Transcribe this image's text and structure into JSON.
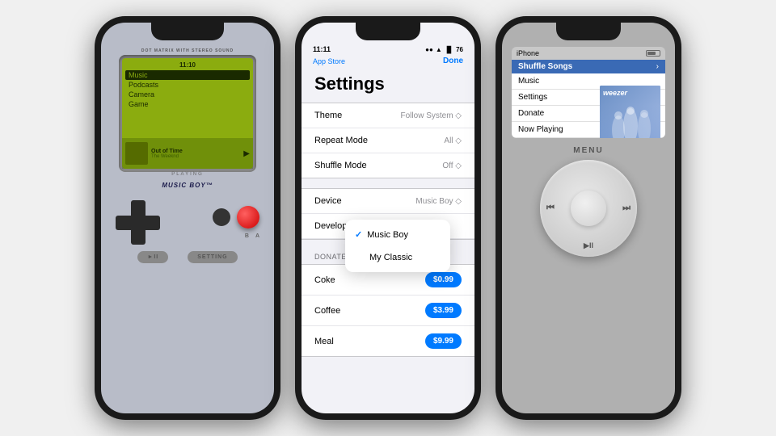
{
  "device1": {
    "brand": "MUSIC BOY",
    "trademark": "™",
    "label_top": "DOT MATRIX WITH STEREO SOUND",
    "screen_time": "11:10",
    "playing_label": "PLAYING",
    "menu_items": [
      "Music",
      "Podcasts",
      "Camera",
      "Game"
    ],
    "active_item": "Music",
    "track_name": "Out of Time",
    "track_artist": "The Weeknd",
    "bottom_btn1": "►II",
    "bottom_btn2": "SETTING"
  },
  "device2": {
    "status_time": "11:11",
    "app_store_label": "App Store",
    "done_label": "Done",
    "title": "Settings",
    "rows": [
      {
        "label": "Theme",
        "value": "Follow System"
      },
      {
        "label": "Repeat Mode",
        "value": "All"
      },
      {
        "label": "Shuffle Mode",
        "value": "Off"
      }
    ],
    "device_row": {
      "label": "Device",
      "value": "Music Boy"
    },
    "developer_row": {
      "label": "Developer",
      "value": ""
    },
    "dropdown_items": [
      {
        "label": "Music Boy",
        "checked": true
      },
      {
        "label": "My Classic",
        "checked": false
      }
    ],
    "donate_section_header": "DONATE",
    "donate_items": [
      {
        "label": "Coke",
        "price": "$0.99"
      },
      {
        "label": "Coffee",
        "price": "$3.99"
      },
      {
        "label": "Meal",
        "price": "$9.99"
      }
    ]
  },
  "device3": {
    "device_name": "iPhone",
    "menu_item": "Shuffle Songs",
    "list_items": [
      "Music",
      "Settings",
      "Donate",
      "Now Playing"
    ],
    "artist": "weezer",
    "wheel_menu": "MENU",
    "wheel_prev": "⏮",
    "wheel_next": "⏭",
    "wheel_play": "▶II"
  }
}
